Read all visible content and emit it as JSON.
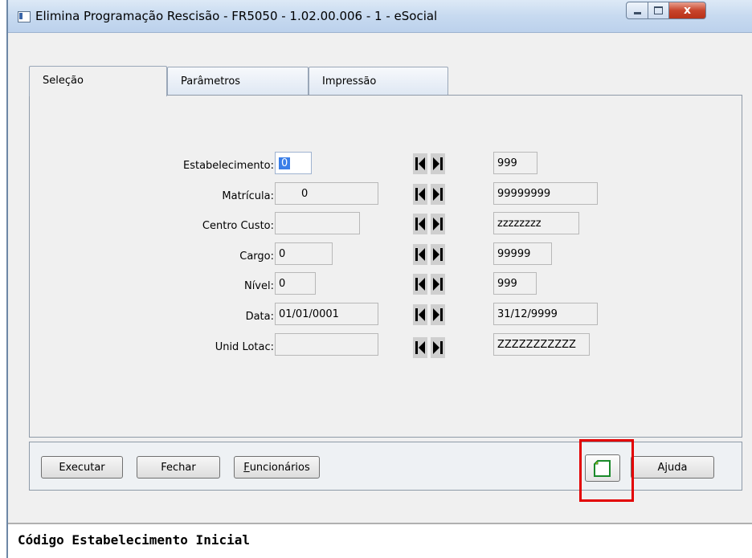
{
  "window": {
    "title": "Elimina Programação Rescisão - FR5050 - 1.02.00.006 - 1 - eSocial",
    "close_glyph": "x"
  },
  "tabs": [
    {
      "label": "Seleção",
      "active": true
    },
    {
      "label": "Parâmetros",
      "active": false
    },
    {
      "label": "Impressão",
      "active": false
    }
  ],
  "fields": [
    {
      "label": "Estabelecimento:",
      "from": "0",
      "to": "999"
    },
    {
      "label": "Matrícula:",
      "from": "0",
      "to": "99999999"
    },
    {
      "label": "Centro Custo:",
      "from": "",
      "to": "zzzzzzzz"
    },
    {
      "label": "Cargo:",
      "from": "0",
      "to": "99999"
    },
    {
      "label": "Nível:",
      "from": "0",
      "to": "999"
    },
    {
      "label": "Data:",
      "from": "01/01/0001",
      "to": "31/12/9999"
    },
    {
      "label": "Unid Lotac:",
      "from": "",
      "to": "ZZZZZZZZZZZ"
    }
  ],
  "buttons": {
    "executar": "Executar",
    "fechar": "Fechar",
    "funcionarios_first": "F",
    "funcionarios_rest": "uncionários",
    "ajuda": "Ajuda"
  },
  "status": "Código Estabelecimento Inicial",
  "colors": {
    "highlight": "#e30000",
    "selection": "#3a7ee8"
  }
}
